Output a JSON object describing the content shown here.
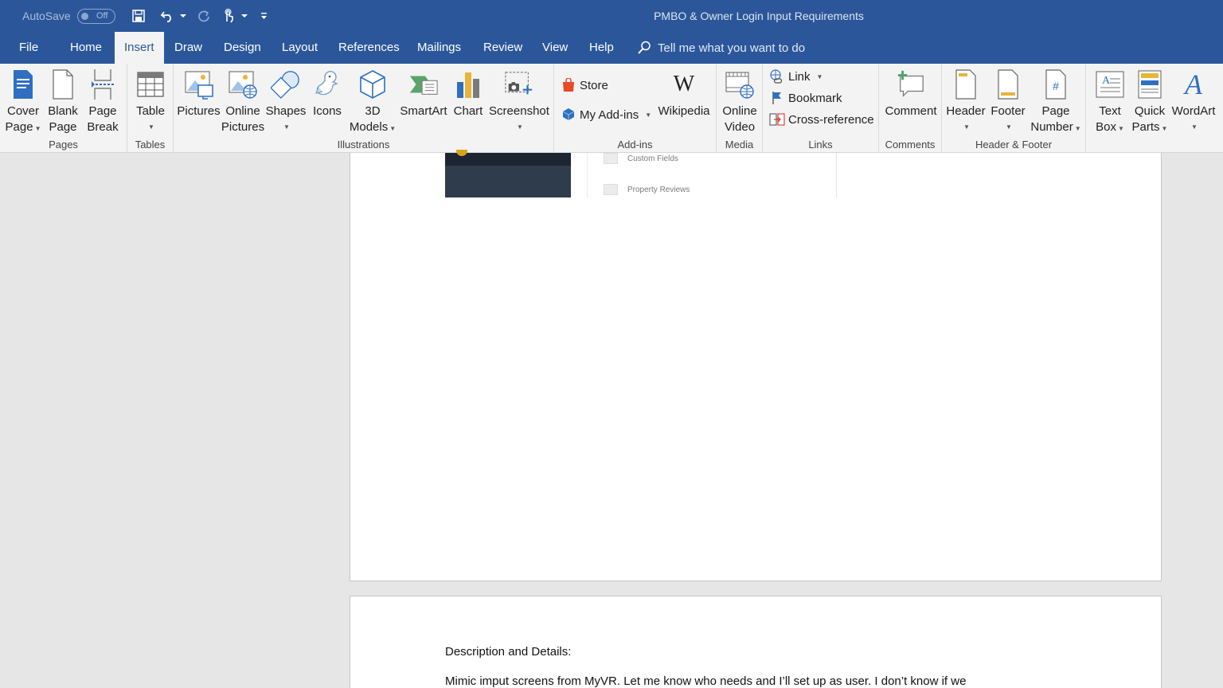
{
  "titlebar": {
    "autosave_label": "AutoSave",
    "autosave_state": "Off",
    "doc_title": "PMBO & Owner Login Input Requirements"
  },
  "tabs": [
    "File",
    "Home",
    "Insert",
    "Draw",
    "Design",
    "Layout",
    "References",
    "Mailings",
    "Review",
    "View",
    "Help"
  ],
  "active_tab": "Insert",
  "tell_me": "Tell me what you want to do",
  "ribbon": {
    "pages": {
      "label": "Pages",
      "cover": [
        "Cover",
        "Page"
      ],
      "blank": [
        "Blank",
        "Page"
      ],
      "break": [
        "Page",
        "Break"
      ]
    },
    "tables": {
      "label": "Tables",
      "table": "Table"
    },
    "illustrations": {
      "label": "Illustrations",
      "pictures": "Pictures",
      "online_pictures": [
        "Online",
        "Pictures"
      ],
      "shapes": "Shapes",
      "icons": "Icons",
      "models": [
        "3D",
        "Models"
      ],
      "smartart": "SmartArt",
      "chart": "Chart",
      "screenshot": "Screenshot"
    },
    "addins": {
      "label": "Add-ins",
      "store": "Store",
      "my_addins": "My Add-ins",
      "wikipedia": "Wikipedia"
    },
    "media": {
      "label": "Media",
      "online_video": [
        "Online",
        "Video"
      ]
    },
    "links": {
      "label": "Links",
      "link": "Link",
      "bookmark": "Bookmark",
      "crossref": "Cross-reference"
    },
    "comments": {
      "label": "Comments",
      "comment": "Comment"
    },
    "header_footer": {
      "label": "Header & Footer",
      "header": "Header",
      "footer": "Footer",
      "page_number": [
        "Page",
        "Number"
      ]
    },
    "text": {
      "text_box": [
        "Text",
        "Box"
      ],
      "quick_parts": [
        "Quick",
        "Parts"
      ],
      "wordart": "WordArt"
    }
  },
  "document": {
    "screenshot_items": [
      "Custom Fields",
      "Property Reviews"
    ],
    "heading": "Description and Details:",
    "body_pre": "Mimic ",
    "body_misspelled": "imput",
    "body_post": " screens from MyVR.  Let me know who needs and I’ll set up as user.  I don’t know if we"
  }
}
